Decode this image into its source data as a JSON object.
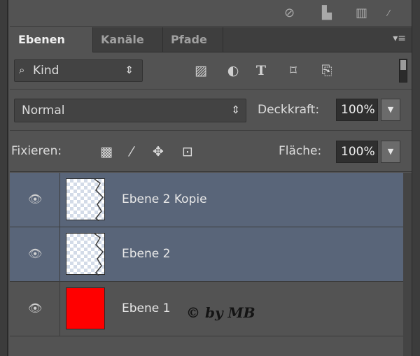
{
  "top_strip": {
    "icons": [
      "no-entry-icon",
      "new-layer-icon",
      "trash-icon",
      "resize-grip-icon"
    ]
  },
  "tabs": [
    {
      "label": "Ebenen",
      "active": true
    },
    {
      "label": "Kanäle",
      "active": false
    },
    {
      "label": "Pfade",
      "active": false
    }
  ],
  "filter": {
    "kind_label": "Kind",
    "icons": [
      "image-filter-icon",
      "adjustment-filter-icon",
      "text-filter-icon",
      "shape-filter-icon",
      "smartobject-filter-icon"
    ]
  },
  "blend": {
    "mode": "Normal",
    "opacity_label": "Deckkraft:",
    "opacity_value": "100%"
  },
  "lock": {
    "label": "Fixieren:",
    "icons": [
      "lock-transparent-icon",
      "lock-image-icon",
      "lock-position-icon",
      "lock-all-icon"
    ],
    "fill_label": "Fläche:",
    "fill_value": "100%"
  },
  "layers": [
    {
      "name": "Ebene 2 Kopie",
      "visible": true,
      "selected": true,
      "thumb": "transparent"
    },
    {
      "name": "Ebene 2",
      "visible": true,
      "selected": true,
      "thumb": "transparent"
    },
    {
      "name": "Ebene 1",
      "visible": true,
      "selected": false,
      "thumb": "red",
      "thumb_color": "#ff0000"
    }
  ],
  "watermark": "© by MB",
  "colors": {
    "panel_bg": "#535353",
    "selected_layer": "#596579",
    "layer1_fill": "#ff0000"
  }
}
